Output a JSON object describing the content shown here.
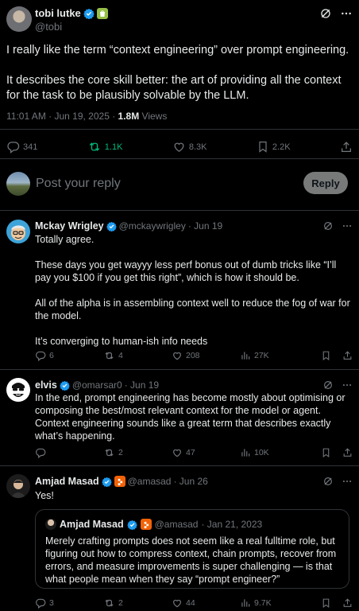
{
  "main_tweet": {
    "author_name": "tobi lutke",
    "author_handle": "@tobi",
    "paragraphs": [
      "I really like the term “context engineering” over prompt engineering.",
      "It describes the core skill better: the art of providing all the context for the task to be plausibly solvable by the LLM."
    ],
    "timestamp": "11:01 AM · Jun 19, 2025 · ",
    "views_count": "1.8M",
    "views_label": " Views",
    "replies": "341",
    "reposts": "1.1K",
    "likes": "8.3K",
    "bookmarks": "2.2K"
  },
  "composer": {
    "placeholder": "Post your reply",
    "button_label": "Reply"
  },
  "replies": [
    {
      "name": "Mckay Wrigley",
      "handle": "@mckaywrigley",
      "date": "· Jun 19",
      "paragraphs": [
        "Totally agree.",
        "These days you get wayyy less perf bonus out of dumb tricks like “I’ll pay you $100 if you get this right”, which is how it should be.",
        "All of the alpha is in assembling context well to reduce the fog of war for the model.",
        "It’s converging to human-ish info needs"
      ],
      "replies": "6",
      "reposts": "4",
      "likes": "208",
      "views": "27K"
    },
    {
      "name": "elvis",
      "handle": "@omarsar0",
      "date": "· Jun 19",
      "paragraphs": [
        "In the end, prompt engineering has become mostly about optimising or composing the best/most relevant context for the model or agent. Context engineering sounds like a great term that describes exactly what’s happening."
      ],
      "replies": "",
      "reposts": "2",
      "likes": "47",
      "views": "10K"
    },
    {
      "name": "Amjad Masad",
      "handle": "@amasad",
      "date": "· Jun 26",
      "paragraphs": [
        "Yes!"
      ],
      "quote": {
        "name": "Amjad Masad",
        "handle": "@amasad",
        "date": "· Jan 21, 2023",
        "text": "Merely crafting prompts does not seem like a real fulltime role, but figuring out how to compress context, chain prompts, recover from errors, and measure improvements is super challenging — is that what people mean when they say “prompt engineer?”"
      },
      "replies": "3",
      "reposts": "2",
      "likes": "44",
      "views": "9.7K"
    }
  ],
  "colors": {
    "background": "#000000",
    "text": "#e7e9ea",
    "muted": "#71767b",
    "verified": "#1d9bf0",
    "repost_active": "#00ba7c",
    "replit_orange": "#f26207",
    "shopify_green": "#95bf47"
  },
  "icons": [
    "verified-badge-icon",
    "shopify-badge-icon",
    "replit-badge-icon",
    "grok-icon",
    "more-icon",
    "reply-icon",
    "repost-icon",
    "like-icon",
    "views-icon",
    "bookmark-icon",
    "share-icon"
  ]
}
